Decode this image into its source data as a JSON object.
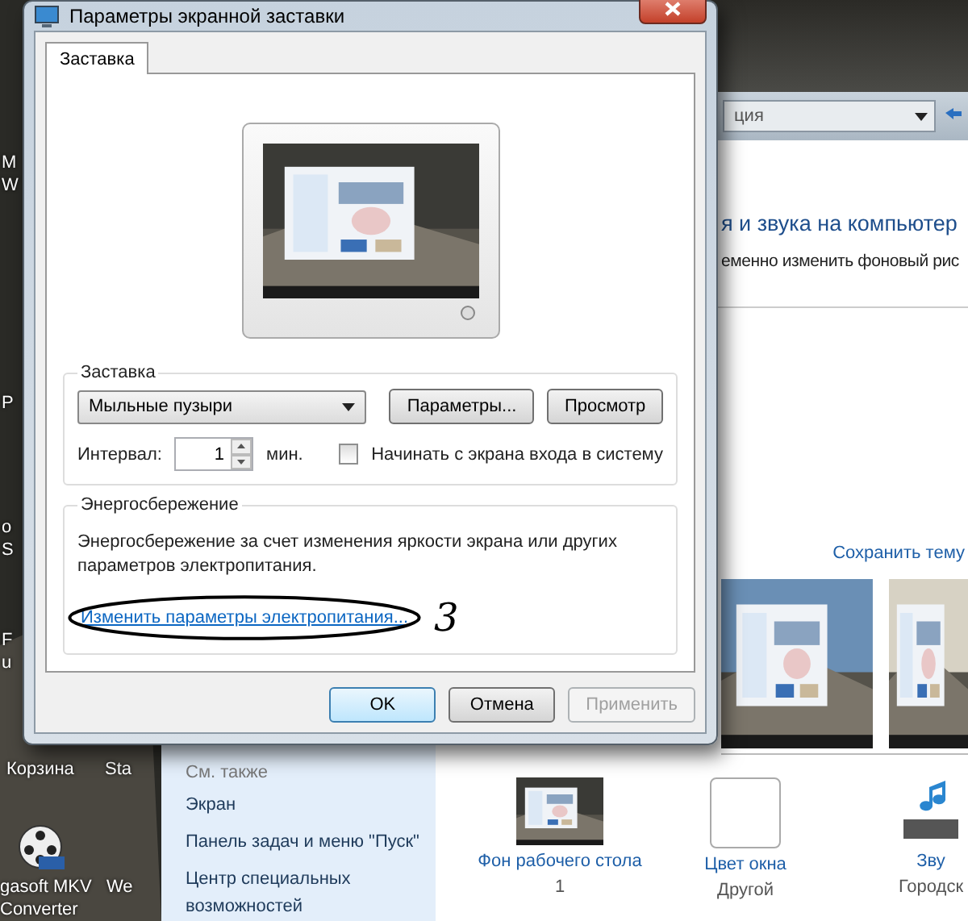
{
  "desktop": {
    "icons": [
      {
        "lines": [
          "M",
          "W"
        ]
      },
      {
        "lines": [
          "P"
        ]
      },
      {
        "lines": [
          "o",
          "S"
        ]
      },
      {
        "lines": [
          "F",
          "u"
        ]
      },
      {
        "lines": [
          "Корзина"
        ]
      },
      {
        "lines": [
          "Sta"
        ]
      },
      {
        "lines": [
          "gasoft MKV",
          "Converter"
        ]
      },
      {
        "lines": [
          "We"
        ]
      }
    ]
  },
  "bg_window": {
    "address": "ция",
    "heading": "я и звука на компьютер",
    "subheading": "еменно изменить фоновый рис",
    "save_theme": "Сохранить тему",
    "see_also": {
      "title": "См. также",
      "links": [
        "Экран",
        "Панель задач и меню \"Пуск\"",
        "Центр специальных возможностей"
      ]
    },
    "items": [
      {
        "title": "Фон рабочего стола",
        "value": "1"
      },
      {
        "kind": "swatch",
        "title": "Цвет окна",
        "value": "Другой"
      },
      {
        "kind": "sound",
        "title": "Зву",
        "value": "Городск"
      }
    ]
  },
  "dialog": {
    "title": "Параметры экранной заставки",
    "tabs": [
      {
        "label": "Заставка",
        "selected": true
      }
    ],
    "screensaver": {
      "legend": "Заставка",
      "value": "Мыльные пузыри",
      "buttons": [
        {
          "label": "Параметры...",
          "disabled": false
        },
        {
          "label": "Просмотр",
          "disabled": false
        }
      ],
      "interval_label": "Интервал:",
      "interval": "1",
      "unit": "мин.",
      "logon": {
        "label": "Начинать с экрана входа в систему",
        "checked": false
      }
    },
    "power": {
      "legend": "Энергосбережение",
      "text": "Энергосбережение за счет изменения яркости экрана или других параметров электропитания.",
      "link": "Изменить параметры электропитания..."
    },
    "annotation": "3",
    "buttons": [
      {
        "label": "OK",
        "default": true,
        "disabled": false
      },
      {
        "label": "Отмена",
        "default": false,
        "disabled": false
      },
      {
        "label": "Применить",
        "default": false,
        "disabled": true
      }
    ]
  }
}
